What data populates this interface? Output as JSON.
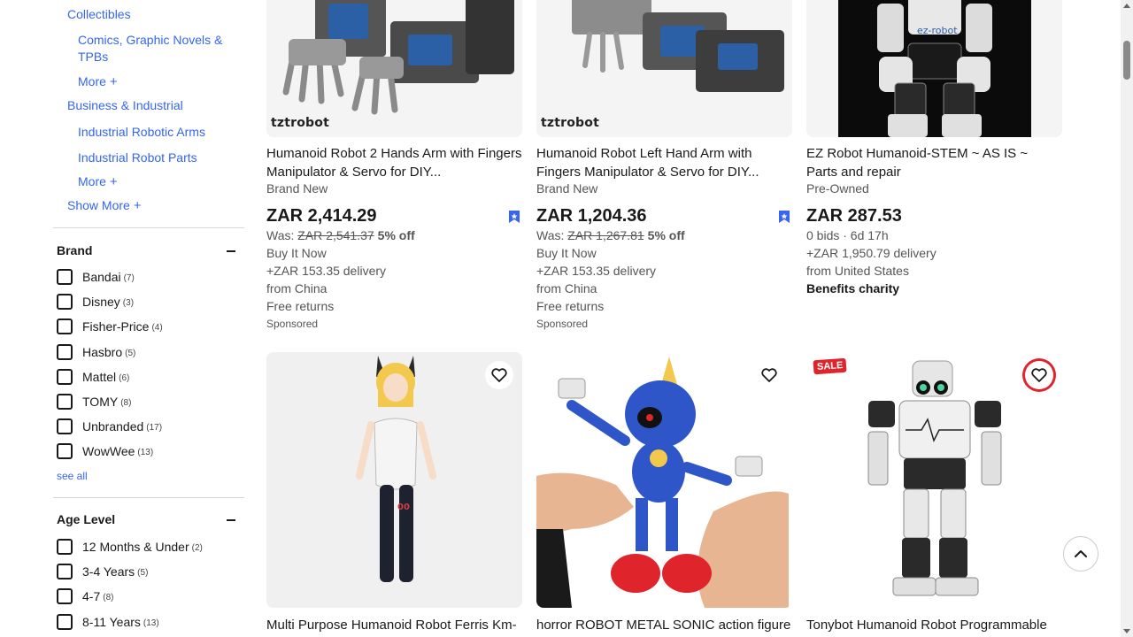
{
  "sidebar": {
    "categories": {
      "collectibles": "Collectibles",
      "comics": "Comics, Graphic Novels & TPBs",
      "more1": "More",
      "business": "Business & Industrial",
      "robotic_arms": "Industrial Robotic Arms",
      "robot_parts": "Industrial Robot Parts",
      "more2": "More",
      "show_more": "Show More",
      "plus": "+"
    },
    "brand": {
      "title": "Brand",
      "items": [
        {
          "label": "Bandai",
          "count": "(7)"
        },
        {
          "label": "Disney",
          "count": "(3)"
        },
        {
          "label": "Fisher-Price",
          "count": "(4)"
        },
        {
          "label": "Hasbro",
          "count": "(5)"
        },
        {
          "label": "Mattel",
          "count": "(6)"
        },
        {
          "label": "TOMY",
          "count": "(8)"
        },
        {
          "label": "Unbranded",
          "count": "(17)"
        },
        {
          "label": "WowWee",
          "count": "(13)"
        }
      ],
      "see_all": "see all"
    },
    "age": {
      "title": "Age Level",
      "items": [
        {
          "label": "12 Months & Under",
          "count": "(2)"
        },
        {
          "label": "3-4 Years",
          "count": "(5)"
        },
        {
          "label": "4-7",
          "count": "(8)"
        },
        {
          "label": "8-11 Years",
          "count": "(13)"
        }
      ]
    }
  },
  "results": [
    {
      "logo": "tztrobot",
      "title": "Humanoid Robot 2 Hands Arm with Fingers Manipulator & Servo for DIY...",
      "condition": "Brand New",
      "price": "ZAR 2,414.29",
      "was_label": "Was:",
      "was_price": "ZAR 2,541.37",
      "discount": "5% off",
      "format": "Buy It Now",
      "delivery": "+ZAR 153.35 delivery",
      "origin": "from China",
      "returns": "Free returns",
      "sponsored": "Sponsored"
    },
    {
      "logo": "tztrobot",
      "title": "Humanoid Robot Left Hand Arm with Fingers Manipulator & Servo for DIY...",
      "condition": "Brand New",
      "price": "ZAR 1,204.36",
      "was_label": "Was:",
      "was_price": "ZAR 1,267.81",
      "discount": "5% off",
      "format": "Buy It Now",
      "delivery": "+ZAR 153.35 delivery",
      "origin": "from China",
      "returns": "Free returns",
      "sponsored": "Sponsored"
    },
    {
      "logo": "ez-robot",
      "title": "EZ Robot Humanoid-STEM ~ AS IS ~ Parts and repair",
      "condition": "Pre-Owned",
      "price": "ZAR 287.53",
      "bids": "0 bids · 6d 17h",
      "delivery": "+ZAR 1,950.79 delivery",
      "origin": "from United States",
      "charity": "Benefits charity"
    },
    {
      "title": "Multi Purpose Humanoid Robot Ferris Km-",
      "figure_label": "00"
    },
    {
      "title": "horror ROBOT METAL SONIC action figure"
    },
    {
      "title": "Tonybot Humanoid Robot Programmable",
      "badge": "SALE"
    }
  ],
  "colors": {
    "link": "#3665f3",
    "text": "#191919",
    "muted": "#555555",
    "sale": "#e0242b"
  },
  "icons": [
    "plus-icon",
    "collapse-icon",
    "bookmark-icon",
    "heart-icon",
    "chevron-up-icon"
  ]
}
